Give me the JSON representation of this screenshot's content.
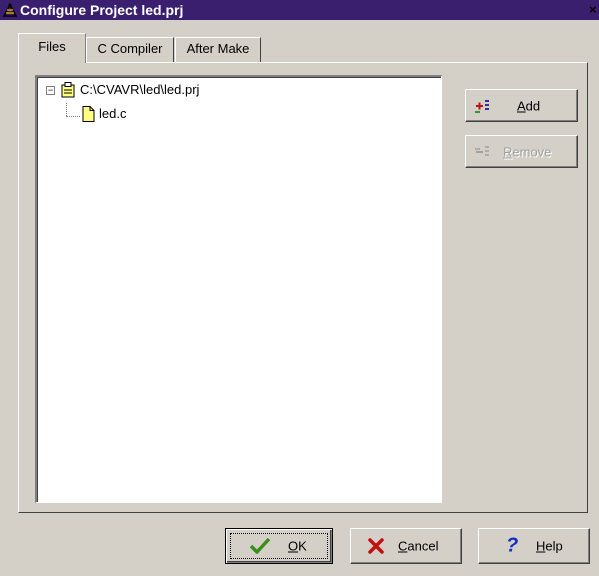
{
  "window": {
    "title": "Configure Project led.prj",
    "close_glyph": "×"
  },
  "tabs": [
    "Files",
    "C Compiler",
    "After Make"
  ],
  "tree": {
    "root": "C:\\CVAVR\\led\\led.prj",
    "children": [
      "led.c"
    ]
  },
  "side_buttons": {
    "add": {
      "mnemonic": "A",
      "rest": "dd"
    },
    "remove": {
      "mnemonic": "R",
      "rest": "emove"
    }
  },
  "bottom_buttons": {
    "ok": {
      "mnemonic": "O",
      "rest": "K"
    },
    "cancel": {
      "mnemonic": "C",
      "rest": "ancel"
    },
    "help": {
      "mnemonic": "H",
      "rest": "elp"
    }
  },
  "colors": {
    "titlebar": "#3a1f6e",
    "ok_check": "#3a8f1c",
    "cancel_x": "#c01010",
    "help_q": "#1030c0",
    "folder_yellow": "#ffff80"
  }
}
